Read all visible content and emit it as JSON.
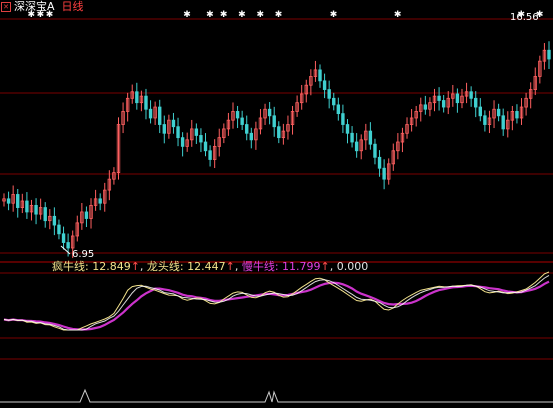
{
  "header": {
    "stock_name": "深深宝A",
    "period": "日线"
  },
  "price_chart": {
    "low_label": "6.95",
    "high_label": "16.56",
    "signal_marker": "✱"
  },
  "indicator_line": {
    "series": [
      {
        "name": "疯牛线",
        "value": "12.849",
        "direction": "↑",
        "color": "#f2e28c"
      },
      {
        "name": "龙头线",
        "value": "12.447",
        "direction": "↑",
        "color": "#f2e28c"
      },
      {
        "name": "慢牛线",
        "value": "11.799",
        "direction": "↑",
        "color": "#e040e0"
      }
    ],
    "trailing_value": "0.000"
  },
  "colors": {
    "background": "#000000",
    "up_candle": "#ff6060",
    "down_candle": "#40d0d0",
    "grid": "#8b0000",
    "fast_line": "#f2e28c",
    "slow_line": "#cc33cc"
  },
  "chart_data": {
    "type": "candlestick",
    "price_min": 6.95,
    "price_max": 16.56,
    "closes": [
      9.2,
      9.0,
      9.4,
      8.8,
      9.1,
      8.6,
      8.9,
      8.5,
      8.8,
      8.2,
      8.4,
      8.0,
      7.6,
      7.2,
      6.95,
      7.5,
      8.1,
      8.6,
      8.3,
      8.9,
      9.2,
      9.0,
      9.6,
      10.1,
      10.4,
      12.6,
      13.2,
      13.8,
      14.1,
      13.6,
      13.9,
      13.3,
      12.9,
      13.4,
      12.6,
      12.2,
      12.8,
      12.5,
      12.0,
      11.6,
      11.9,
      12.4,
      12.1,
      11.8,
      11.4,
      11.0,
      11.6,
      12.0,
      12.4,
      12.8,
      13.2,
      12.9,
      12.6,
      12.2,
      11.9,
      12.4,
      12.9,
      13.3,
      13.0,
      12.5,
      12.0,
      12.3,
      12.6,
      13.2,
      13.6,
      14.0,
      14.4,
      14.8,
      15.1,
      14.6,
      14.2,
      13.8,
      13.5,
      13.1,
      12.6,
      12.2,
      11.8,
      11.4,
      11.9,
      12.3,
      11.7,
      11.1,
      10.6,
      10.1,
      10.8,
      11.4,
      11.8,
      12.2,
      12.6,
      12.9,
      13.2,
      13.5,
      13.3,
      13.6,
      13.9,
      13.7,
      13.4,
      13.8,
      14.0,
      13.6,
      13.9,
      14.1,
      13.8,
      13.4,
      13.0,
      12.6,
      12.9,
      13.3,
      13.0,
      12.4,
      12.8,
      13.2,
      12.9,
      13.4,
      13.8,
      14.2,
      14.8,
      15.5,
      16.0,
      15.6
    ],
    "signal_marker_indices": [
      6,
      8,
      10,
      40,
      45,
      48,
      52,
      56,
      60,
      72,
      86,
      113,
      117
    ]
  }
}
